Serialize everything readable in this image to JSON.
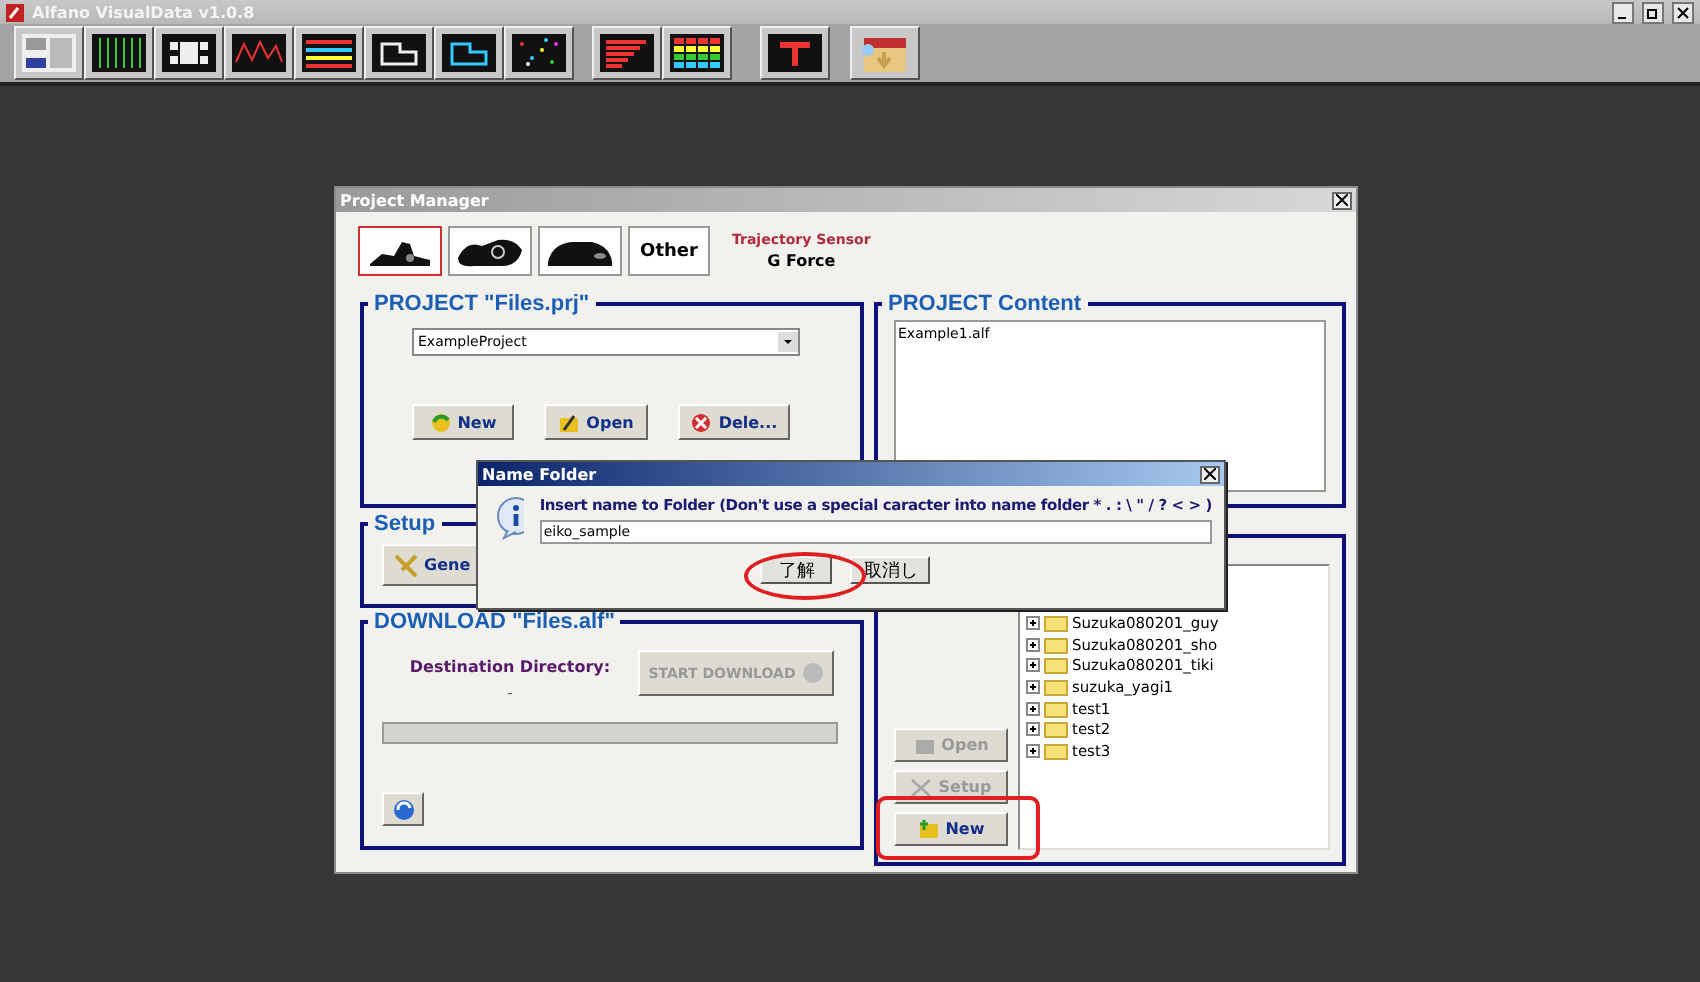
{
  "app": {
    "title": "Alfano VisualData v1.0.8"
  },
  "project_manager": {
    "title": "Project Manager",
    "vehicles": [
      {
        "kind": "kart",
        "selected": true
      },
      {
        "kind": "bike",
        "selected": false
      },
      {
        "kind": "car",
        "selected": false
      },
      {
        "kind": "text",
        "label": "Other",
        "selected": false
      }
    ],
    "sensor_label": "Trajectory Sensor",
    "sensor_value": "G Force",
    "project": {
      "title": "PROJECT \"Files.prj\"",
      "dropdown": "ExampleProject",
      "buttons": [
        {
          "label": "New"
        },
        {
          "label": "Open"
        },
        {
          "label": "Dele..."
        }
      ]
    },
    "setup": {
      "title": "Setup",
      "button": "Gene"
    },
    "download": {
      "title": "DOWNLOAD \"Files.alf\"",
      "destination_label": "Destination Directory:",
      "destination_value": "-",
      "start_button": {
        "label": "START DOWNLOAD",
        "disabled": true
      },
      "progress": {
        "level": 0
      }
    },
    "content": {
      "title": "PROJECT Content",
      "files": [
        "Example1.alf"
      ]
    },
    "folders": {
      "buttons": [
        {
          "label": "Open",
          "disabled": true,
          "highlighted": false
        },
        {
          "label": "Setup",
          "disabled": true,
          "highlighted": false
        },
        {
          "label": "New",
          "disabled": false,
          "highlighted": true
        }
      ],
      "tree": [
        "Suzuka080201_guy",
        "Suzuka080201_sho",
        "Suzuka080201_tiki",
        "suzuka_yagi1",
        "test1",
        "test2",
        "test3"
      ]
    }
  },
  "dialog": {
    "title": "Name Folder",
    "message": "Insert name to Folder (Don't use a special caracter into name folder * . : \\ \" / ? < > )",
    "value": "eiko_sample",
    "buttons": [
      {
        "label": "了解",
        "circled": true
      },
      {
        "label": "取消し",
        "circled": false
      }
    ]
  }
}
